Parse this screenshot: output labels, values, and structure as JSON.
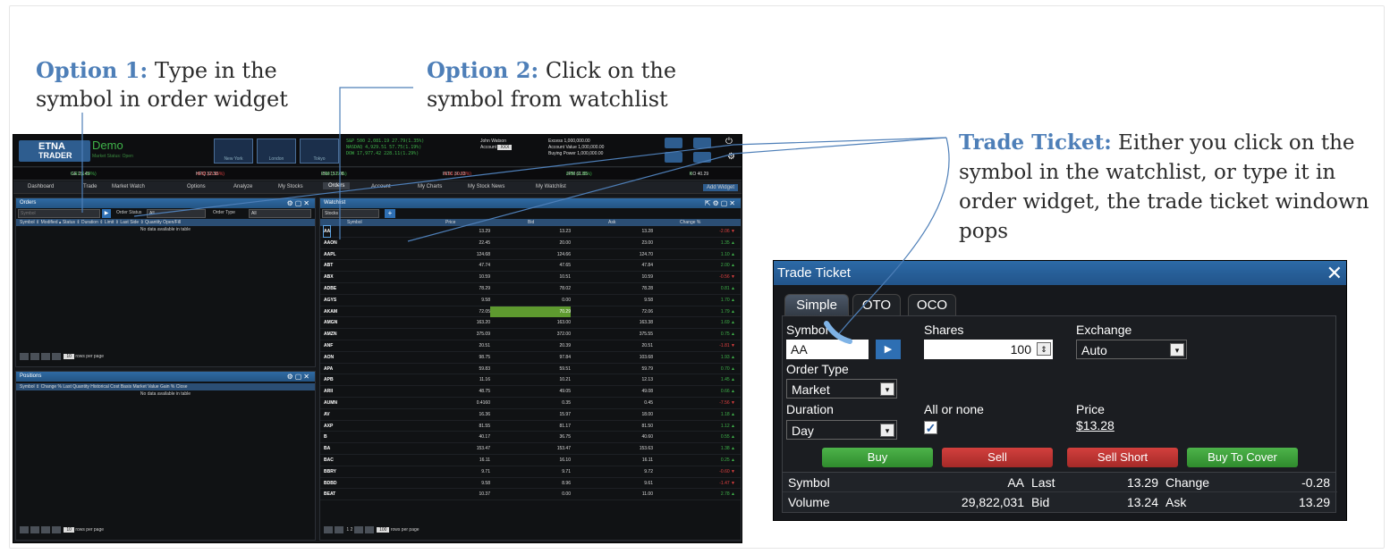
{
  "annotations": {
    "opt1_head": "Option 1:",
    "opt1_body": " Type in the symbol in order widget",
    "opt2_head": "Option 2:",
    "opt2_body": " Click on the symbol from watchlist",
    "tt_head": "Trade Ticket:",
    "tt_body": " Either you click on the symbol in the watchlist, or type it in order widget,  the trade ticket windown pops"
  },
  "colors": {
    "accent": "#4e7fb8",
    "panel_header": "#2f6aa3",
    "up": "#3fb34a",
    "down": "#e04040"
  },
  "platform": {
    "brand": "ETNA",
    "brand_sub": "TRADER",
    "env": "Demo",
    "market_status": "Market Status: Open",
    "cities": [
      "New York",
      "London",
      "Tokyo"
    ],
    "indices": [
      "S&P 500    2,081.19   27.79(1.35%)",
      "NASDAQ    4,929.51   57.75(1.19%)",
      "DOW         17,977.42  228.11(1.29%)"
    ],
    "account": {
      "user": "John Watson",
      "account_label": "Account",
      "account_value": "XXX"
    },
    "balances": [
      "Excess                 1,000,000.00",
      "Account Value   1,000,000.00",
      "Buying Power    1,000,000.00"
    ],
    "ticker": [
      {
        "sym": "GE 25.45",
        "chg": "0.41 (1.64%)"
      },
      {
        "sym": "HPQ 32.38",
        "chg": "-0.02 (-0.15%)"
      },
      {
        "sym": "IBM 157.08",
        "chg": "2.80 (1.81%)"
      },
      {
        "sym": "INTC 30.83",
        "chg": "-0.16 (-0.52%)"
      },
      {
        "sym": "JPM 61.85",
        "chg": "0.85 (1.39%)"
      },
      {
        "sym": "KO 40.29",
        "chg": "0"
      }
    ],
    "tabs": [
      "Dashboard",
      "Trade",
      "Market Watch",
      "Options",
      "Analyze",
      "My Stocks",
      "Orders",
      "Account",
      "My Charts",
      "My Stock News",
      "My Watchlist"
    ],
    "active_tab": "Orders",
    "add_widget": "Add Widget",
    "orders": {
      "title": "Orders",
      "symbol_placeholder": "Symbol",
      "status_label": "Order Status",
      "status_value": "All",
      "type_label": "Order Type",
      "type_value": "All",
      "columns": "Symbol  ⇕  Modified  ▴  Status  ⇕  Duration  ⇕  Limit  ⇕  Last  Side  ⇕  Quantity    Open/Fill",
      "empty": "No data available in table",
      "per_page": "10",
      "rows_label": "rows per page"
    },
    "positions": {
      "title": "Positions",
      "columns": "Symbol  ⇕  Change %  Last  Quantity    Historical Cost Basis    Market Value  Gain %  Close",
      "empty": "No data available in table",
      "per_page": "10",
      "rows_label": "rows per page"
    },
    "watchlist": {
      "title": "Watchlist",
      "list_name": "Stocks",
      "headers": [
        "Symbol",
        "Price",
        "Bid",
        "Ask",
        "Change %"
      ],
      "rows": [
        {
          "sym": "AA",
          "price": "13.29",
          "bid": "13.23",
          "ask": "13.28",
          "chg": "-2.06",
          "dir": "neg"
        },
        {
          "sym": "AAON",
          "price": "22.45",
          "bid": "20.00",
          "ask": "23.00",
          "chg": "1.35",
          "dir": "pos"
        },
        {
          "sym": "AAPL",
          "price": "124.68",
          "bid": "124.66",
          "ask": "124.70",
          "chg": "1.10",
          "dir": "pos"
        },
        {
          "sym": "ABT",
          "price": "47.74",
          "bid": "47.65",
          "ask": "47.84",
          "chg": "2.00",
          "dir": "pos"
        },
        {
          "sym": "ABX",
          "price": "10.59",
          "bid": "10.51",
          "ask": "10.59",
          "chg": "-0.56",
          "dir": "neg"
        },
        {
          "sym": "ADBE",
          "price": "78.29",
          "bid": "78.02",
          "ask": "78.28",
          "chg": "0.81",
          "dir": "pos"
        },
        {
          "sym": "AGYS",
          "price": "9.58",
          "bid": "0.00",
          "ask": "9.58",
          "chg": "1.70",
          "dir": "pos"
        },
        {
          "sym": "AKAM",
          "price": "72.05",
          "bid": "70.29",
          "ask": "72.06",
          "chg": "1.79",
          "dir": "pos"
        },
        {
          "sym": "AMGN",
          "price": "163.20",
          "bid": "163.00",
          "ask": "163.38",
          "chg": "1.69",
          "dir": "pos"
        },
        {
          "sym": "AMZN",
          "price": "375.09",
          "bid": "372.00",
          "ask": "375.55",
          "chg": "0.75",
          "dir": "pos"
        },
        {
          "sym": "ANF",
          "price": "20.51",
          "bid": "20.39",
          "ask": "20.51",
          "chg": "-1.81",
          "dir": "neg"
        },
        {
          "sym": "AON",
          "price": "98.75",
          "bid": "97.84",
          "ask": "103.68",
          "chg": "1.93",
          "dir": "pos"
        },
        {
          "sym": "APA",
          "price": "59.83",
          "bid": "59.51",
          "ask": "59.79",
          "chg": "0.70",
          "dir": "pos"
        },
        {
          "sym": "APB",
          "price": "11.16",
          "bid": "10.21",
          "ask": "12.13",
          "chg": "1.45",
          "dir": "pos"
        },
        {
          "sym": "ARII",
          "price": "48.75",
          "bid": "49.05",
          "ask": "49.08",
          "chg": "0.66",
          "dir": "pos"
        },
        {
          "sym": "AUMN",
          "price": "0.4160",
          "bid": "0.35",
          "ask": "0.45",
          "chg": "-7.56",
          "dir": "neg"
        },
        {
          "sym": "AV",
          "price": "16.36",
          "bid": "15.97",
          "ask": "18.00",
          "chg": "1.18",
          "dir": "pos"
        },
        {
          "sym": "AXP",
          "price": "81.55",
          "bid": "81.17",
          "ask": "81.50",
          "chg": "1.12",
          "dir": "pos"
        },
        {
          "sym": "B",
          "price": "40.17",
          "bid": "36.75",
          "ask": "40.60",
          "chg": "0.55",
          "dir": "pos"
        },
        {
          "sym": "BA",
          "price": "153.47",
          "bid": "153.47",
          "ask": "153.63",
          "chg": "1.38",
          "dir": "pos"
        },
        {
          "sym": "BAC",
          "price": "16.11",
          "bid": "16.10",
          "ask": "16.11",
          "chg": "0.25",
          "dir": "pos"
        },
        {
          "sym": "BBRY",
          "price": "9.71",
          "bid": "9.71",
          "ask": "9.72",
          "chg": "-0.60",
          "dir": "neg"
        },
        {
          "sym": "BDBD",
          "price": "9.58",
          "bid": "8.96",
          "ask": "9.61",
          "chg": "-1.47",
          "dir": "neg"
        },
        {
          "sym": "BEAT",
          "price": "10.37",
          "bid": "0.00",
          "ask": "11.00",
          "chg": "2.78",
          "dir": "pos"
        }
      ],
      "per_page": "100",
      "rows_label": "rows per page",
      "pages": [
        "1",
        "2"
      ]
    }
  },
  "ticket": {
    "title": "Trade Ticket",
    "tabs": [
      "Simple",
      "OTO",
      "OCO"
    ],
    "active_tab": "Simple",
    "symbol_label": "Symbol",
    "symbol_value": "AA",
    "shares_label": "Shares",
    "shares_value": "100",
    "exchange_label": "Exchange",
    "exchange_value": "Auto",
    "order_type_label": "Order Type",
    "order_type_value": "Market",
    "duration_label": "Duration",
    "duration_value": "Day",
    "aon_label": "All or none",
    "aon_checked": true,
    "price_label": "Price",
    "price_value": "$13.28",
    "buttons": {
      "buy": "Buy",
      "sell": "Sell",
      "sell_short": "Sell Short",
      "buy_to_cover": "Buy To Cover"
    },
    "quote": {
      "symbol_label": "Symbol",
      "symbol_value": "AA",
      "last_label": "Last",
      "last_value": "13.29",
      "change_label": "Change",
      "change_value": "-0.28",
      "volume_label": "Volume",
      "volume_value": "29,822,031",
      "bid_label": "Bid",
      "bid_value": "13.24",
      "ask_label": "Ask",
      "ask_value": "13.29"
    }
  }
}
